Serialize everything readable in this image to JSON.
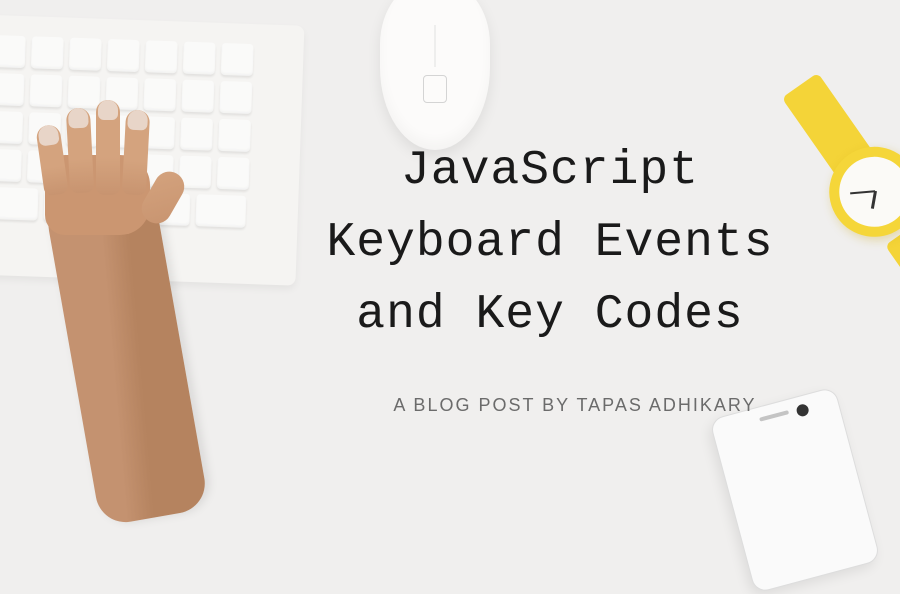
{
  "title": {
    "line1": "JavaScript",
    "line2": "Keyboard Events",
    "line3": "and Key Codes"
  },
  "subtitle": "A BLOG POST BY TAPAS ADHIKARY",
  "objects": {
    "keyboard": "white-keyboard",
    "mouse": "apple-magic-mouse",
    "watch": "yellow-watch",
    "phone": "white-smartphone",
    "hand": "typing-hand"
  }
}
